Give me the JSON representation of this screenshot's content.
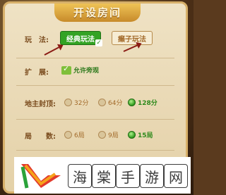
{
  "dialog": {
    "title": "开设房间"
  },
  "play_mode": {
    "label": "玩　法:",
    "options": [
      {
        "label": "经典玩法",
        "selected": true
      },
      {
        "label": "癞子玩法",
        "selected": false
      }
    ]
  },
  "extension": {
    "label": "扩　展:",
    "allow_spectate": "允许旁观",
    "checked": true
  },
  "landlord_cap": {
    "label": "地主封顶:",
    "options": [
      {
        "label": "32分",
        "selected": false
      },
      {
        "label": "64分",
        "selected": false
      },
      {
        "label": "128分",
        "selected": true
      }
    ]
  },
  "rounds": {
    "label": "局　　数:",
    "options": [
      {
        "label": "6局",
        "selected": false
      },
      {
        "label": "9局",
        "selected": false
      },
      {
        "label": "15局",
        "selected": true
      }
    ]
  },
  "watermark": {
    "chars": [
      "海",
      "棠",
      "手",
      "游",
      "网"
    ]
  },
  "colors": {
    "accent_green": "#33a324",
    "arrow_red": "#8a1b14",
    "label_brown": "#7a4b1d"
  }
}
